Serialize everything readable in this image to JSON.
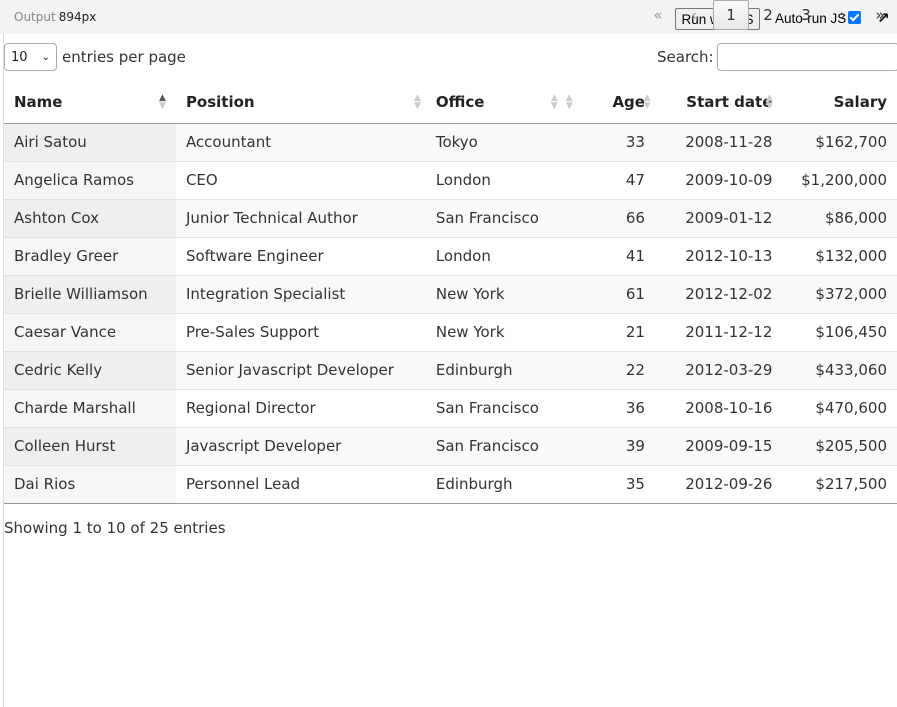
{
  "output_bar": {
    "label": "Output",
    "width_text": "894px",
    "run_button": "Run with JS",
    "autorun_label": "Auto-run JS",
    "autorun_checked": true,
    "popout_icon": "external-arrow-icon"
  },
  "controls": {
    "page_length": "10",
    "page_length_label": "entries per page",
    "search_label": "Search:",
    "search_value": ""
  },
  "table": {
    "columns": [
      "Name",
      "Position",
      "Office",
      "Age",
      "Start date",
      "Salary"
    ],
    "sorted_column": "Name",
    "sort_direction": "ascending",
    "rows": [
      [
        "Airi Satou",
        "Accountant",
        "Tokyo",
        "33",
        "2008-11-28",
        "$162,700"
      ],
      [
        "Angelica Ramos",
        "CEO",
        "London",
        "47",
        "2009-10-09",
        "$1,200,000"
      ],
      [
        "Ashton Cox",
        "Junior Technical Author",
        "San Francisco",
        "66",
        "2009-01-12",
        "$86,000"
      ],
      [
        "Bradley Greer",
        "Software Engineer",
        "London",
        "41",
        "2012-10-13",
        "$132,000"
      ],
      [
        "Brielle Williamson",
        "Integration Specialist",
        "New York",
        "61",
        "2012-12-02",
        "$372,000"
      ],
      [
        "Caesar Vance",
        "Pre-Sales Support",
        "New York",
        "21",
        "2011-12-12",
        "$106,450"
      ],
      [
        "Cedric Kelly",
        "Senior Javascript Developer",
        "Edinburgh",
        "22",
        "2012-03-29",
        "$433,060"
      ],
      [
        "Charde Marshall",
        "Regional Director",
        "San Francisco",
        "36",
        "2008-10-16",
        "$470,600"
      ],
      [
        "Colleen Hurst",
        "Javascript Developer",
        "San Francisco",
        "39",
        "2009-09-15",
        "$205,500"
      ],
      [
        "Dai Rios",
        "Personnel Lead",
        "Edinburgh",
        "35",
        "2012-09-26",
        "$217,500"
      ]
    ]
  },
  "footer": {
    "info": "Showing 1 to 10 of 25 entries",
    "pagination": {
      "first": "«",
      "previous": "‹",
      "pages": [
        "1",
        "2",
        "3"
      ],
      "current_page": "1",
      "next": "›",
      "last": "»"
    }
  },
  "colors": {
    "output_bar": "#f3f3f3",
    "checkbox": "#0075ff",
    "stripe": "#f9f9f9"
  }
}
